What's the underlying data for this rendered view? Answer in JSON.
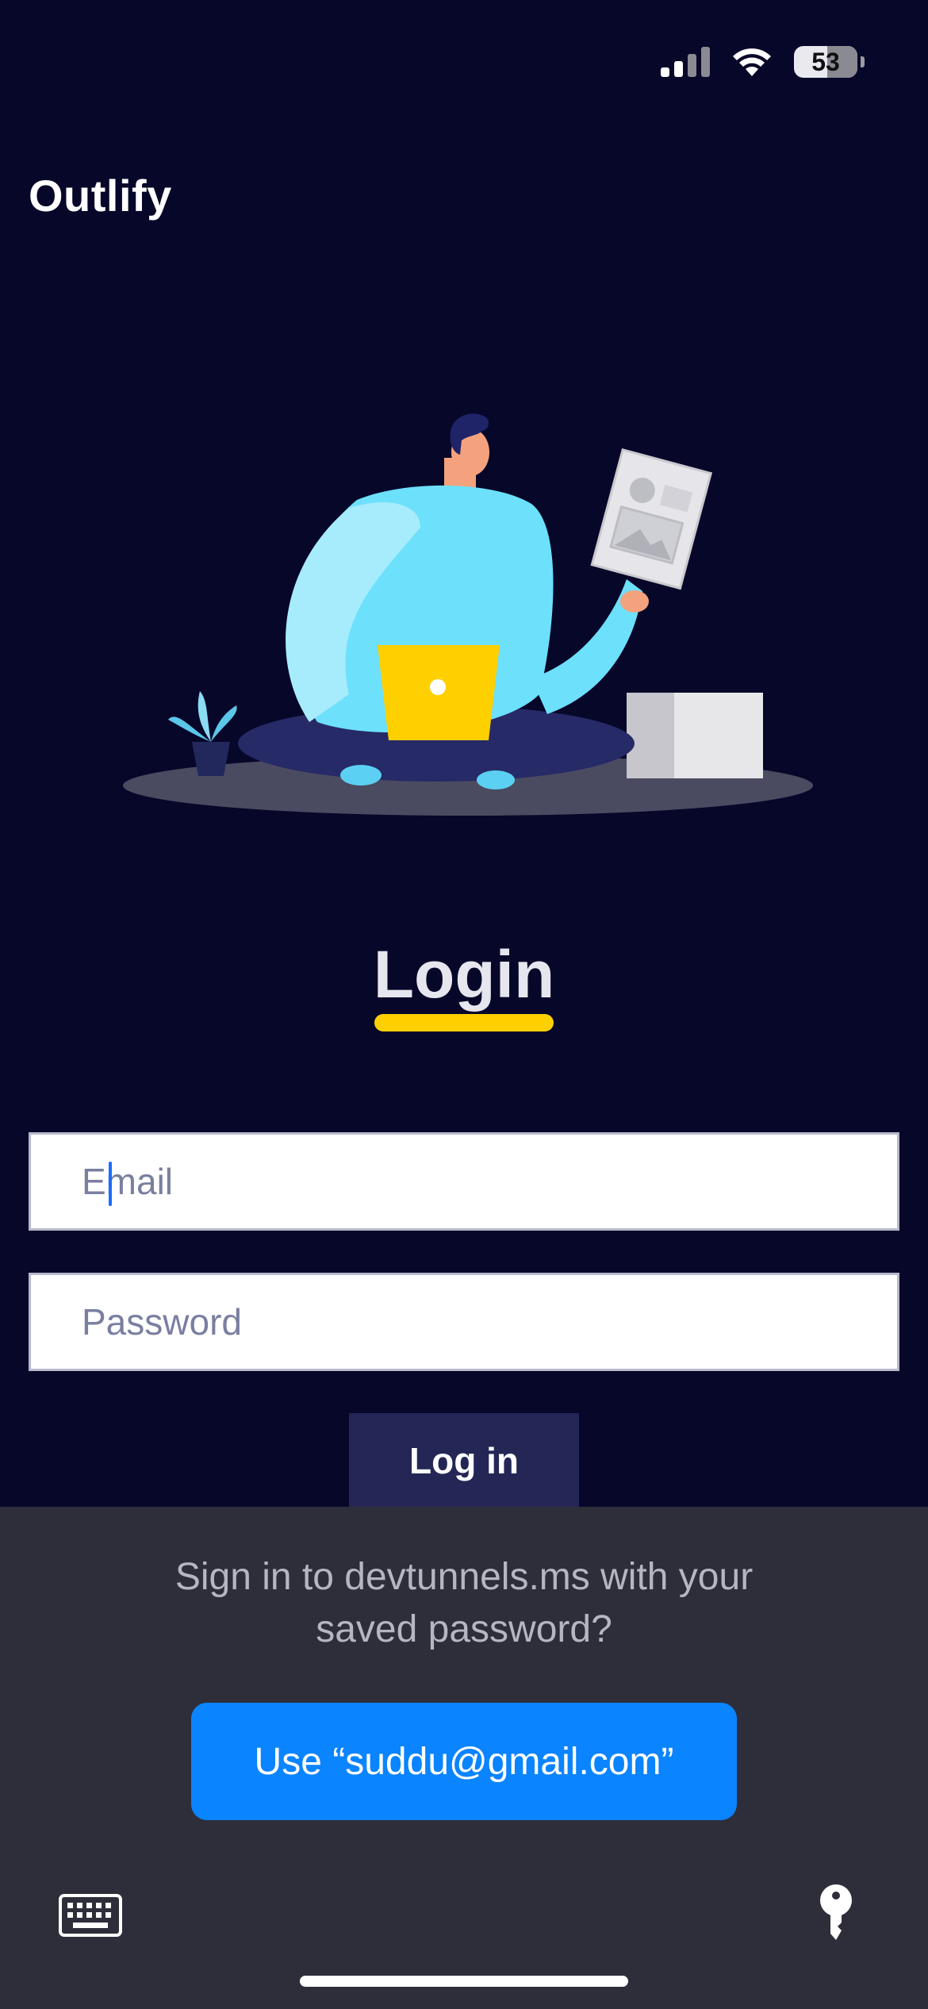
{
  "status_bar": {
    "battery": "53",
    "battery_level_percent": 53
  },
  "app": {
    "brand": "Outlify"
  },
  "login": {
    "title": "Login",
    "email_placeholder": "Email",
    "password_placeholder": "Password",
    "submit_label": "Log in"
  },
  "password_sheet": {
    "prompt_line1": "Sign in to devtunnels.ms with your",
    "prompt_line2": "saved password?",
    "use_button": "Use “suddu@gmail.com”"
  },
  "colors": {
    "background": "#07072a",
    "accent_yellow": "#ffd000",
    "button_dark": "#242656",
    "ios_blue": "#0a84ff",
    "sheet_bg": "#2d2e3a"
  },
  "icons": [
    "signal-icon",
    "wifi-icon",
    "battery-icon",
    "keyboard-icon",
    "key-icon"
  ]
}
